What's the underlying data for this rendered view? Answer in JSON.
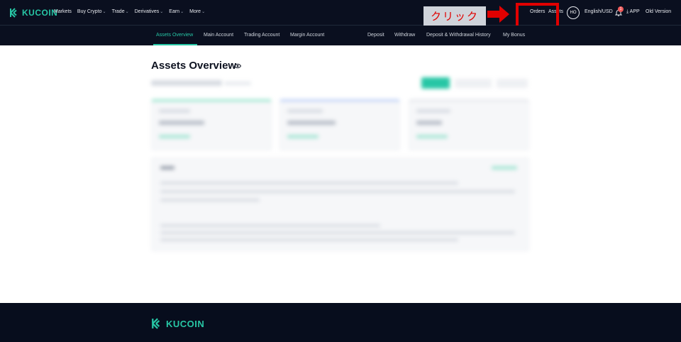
{
  "header": {
    "brand": "KUCOIN",
    "nav": [
      {
        "label": "Markets",
        "dropdown": false
      },
      {
        "label": "Buy Crypto",
        "dropdown": true
      },
      {
        "label": "Trade",
        "dropdown": true
      },
      {
        "label": "Derivatives",
        "dropdown": true
      },
      {
        "label": "Earn",
        "dropdown": true
      },
      {
        "label": "More",
        "dropdown": true
      }
    ],
    "orders": "Orders",
    "assets": "Assets",
    "avatar_initials": "HO",
    "language": "English/USD",
    "notification_count": "1",
    "app": "APP",
    "old_version": "Old Version"
  },
  "annotation": {
    "label": "クリック",
    "color": "#e00000"
  },
  "subnav": {
    "left": [
      "Assets Overview",
      "Main Account",
      "Trading Account",
      "Margin Account"
    ],
    "right": [
      "Deposit",
      "Withdraw",
      "Deposit & Withdrawal History",
      "My Bonus"
    ]
  },
  "main": {
    "title": "Assets Overview"
  },
  "footer": {
    "brand": "KUCOIN"
  },
  "colors": {
    "brand": "#27c6a5",
    "header_bg": "#0a0f1f",
    "footer_bg": "#070d1d"
  }
}
